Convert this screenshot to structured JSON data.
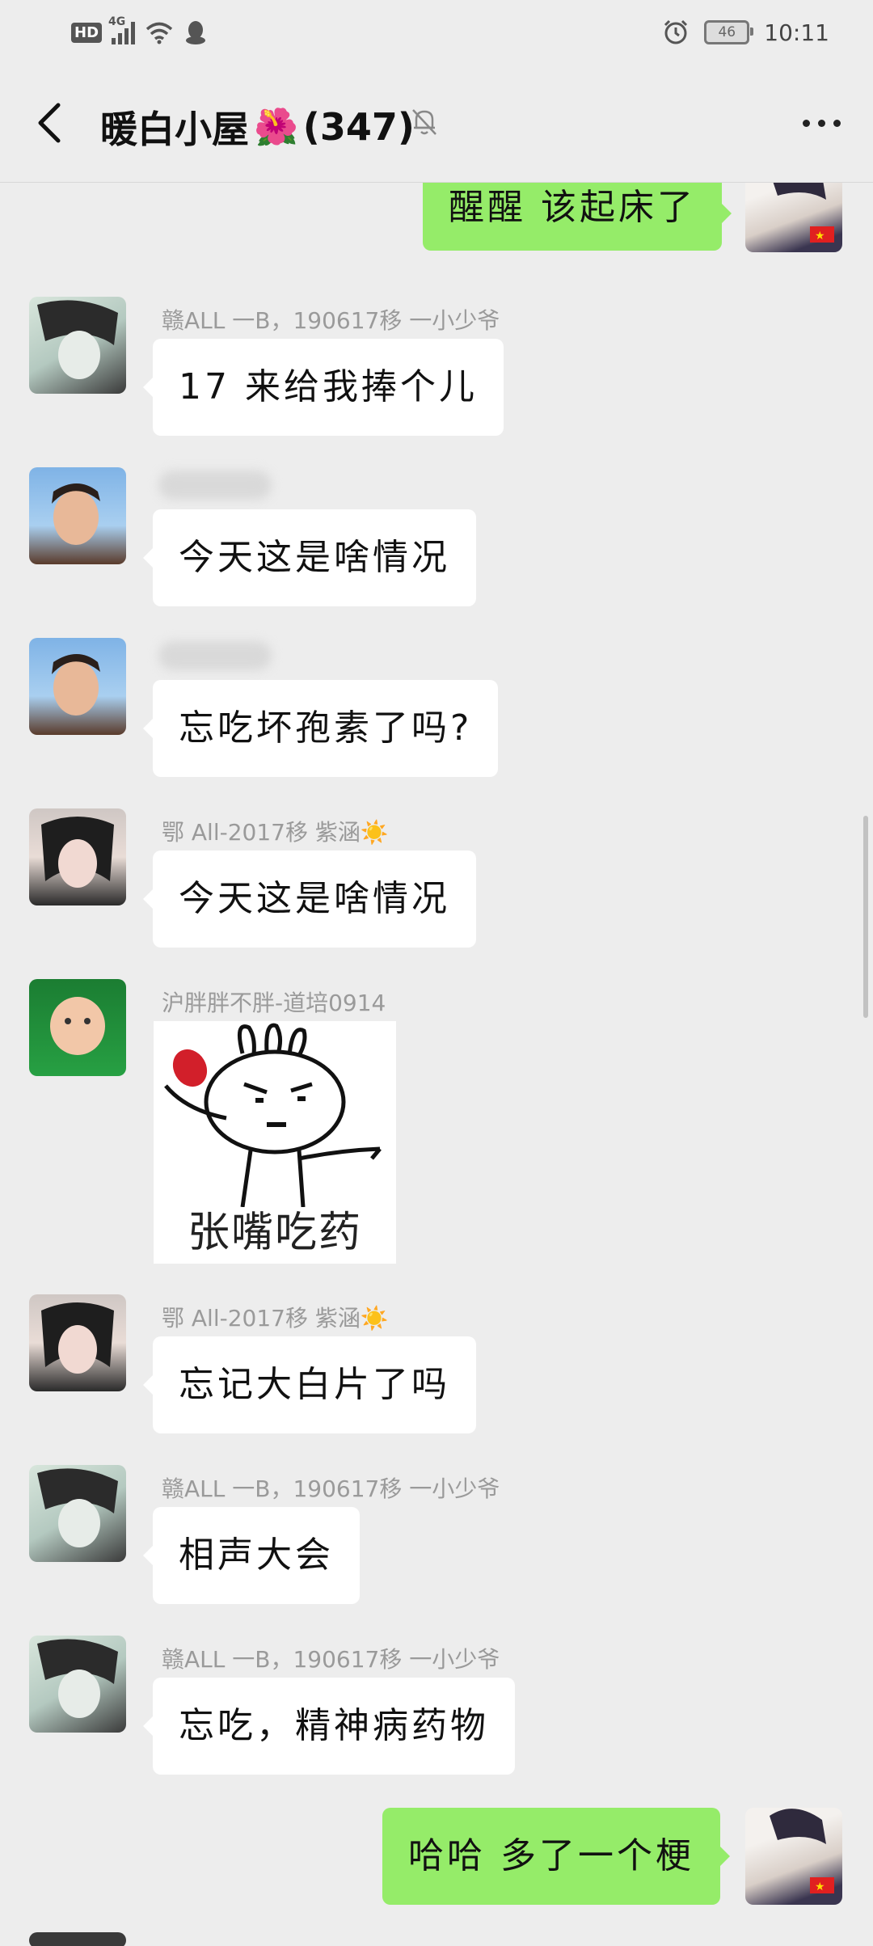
{
  "status_bar": {
    "hd": "HD",
    "network": "4G",
    "battery": "46",
    "time": "10:11"
  },
  "header": {
    "title": "暖白小屋",
    "title_emoji": "🌺",
    "member_count": "(347)"
  },
  "messages": [
    {
      "side": "out",
      "text": "醒醒 该起床了"
    },
    {
      "side": "in",
      "sender": "赣ALL 一B，190617移 一小少爷",
      "text": "17 来给我捧个儿"
    },
    {
      "side": "in",
      "sender": "",
      "text": "今天这是啥情况"
    },
    {
      "side": "in",
      "sender": "",
      "text": "忘吃坏孢素了吗?"
    },
    {
      "side": "in",
      "sender": "鄂 All-2017移 紫涵☀️",
      "text": "今天这是啥情况"
    },
    {
      "side": "in",
      "sender": "沪胖胖不胖-道培0914",
      "sticker_text": "张嘴吃药"
    },
    {
      "side": "in",
      "sender": "鄂 All-2017移 紫涵☀️",
      "text": "忘记大白片了吗"
    },
    {
      "side": "in",
      "sender": "赣ALL 一B，190617移 一小少爷",
      "text": "相声大会"
    },
    {
      "side": "in",
      "sender": "赣ALL 一B，190617移 一小少爷",
      "text": "忘吃，精神病药物"
    },
    {
      "side": "out",
      "text": "哈哈 多了一个梗"
    }
  ],
  "colors": {
    "background": "#ededed",
    "bubble_out": "#95ec69",
    "bubble_in": "#ffffff"
  }
}
